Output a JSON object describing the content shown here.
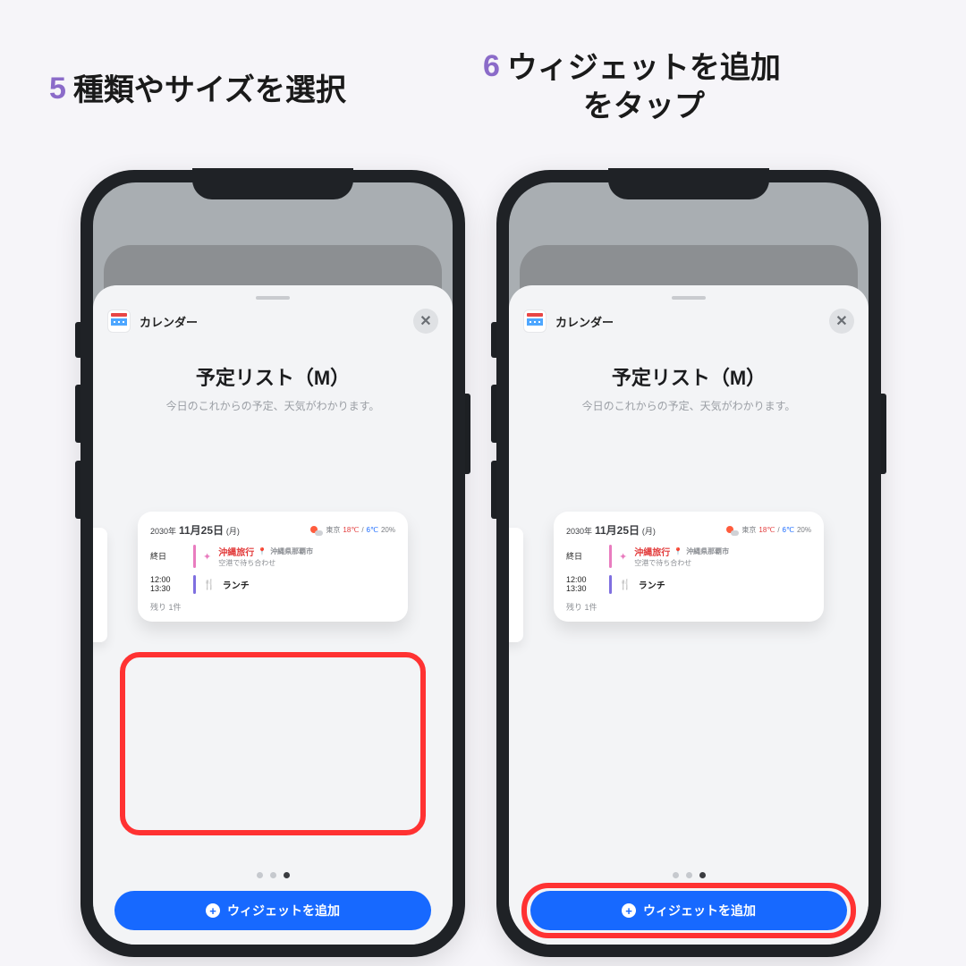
{
  "steps": {
    "five": {
      "num": "5",
      "text": "種類やサイズを選択"
    },
    "six": {
      "num": "6",
      "text": "ウィジェットを追加\nをタップ"
    }
  },
  "sheet": {
    "app_name": "カレンダー",
    "title": "予定リスト（M）",
    "subtitle": "今日のこれからの予定、天気がわかります。",
    "add_button": "ウィジェットを追加"
  },
  "preview": {
    "date_year_prefix": "2030年",
    "date_md": "11月25日",
    "date_dow": "(月)",
    "weather_loc": "東京",
    "temp_hi": "18℃",
    "temp_sep": "/",
    "temp_lo": "6℃",
    "precip": "20%",
    "row1": {
      "time": "終日",
      "title": "沖縄旅行",
      "loc": "沖縄県那覇市",
      "note": "空港で待ち合わせ"
    },
    "row2": {
      "time1": "12:00",
      "time2": "13:30",
      "title": "ランチ"
    },
    "remaining": "残り 1件"
  }
}
